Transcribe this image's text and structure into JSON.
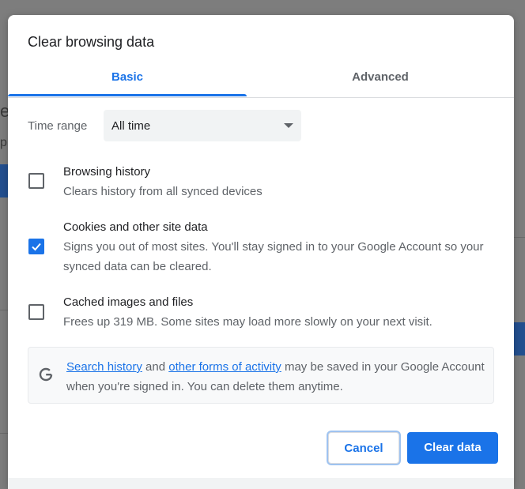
{
  "dialog": {
    "title": "Clear browsing data"
  },
  "tabs": [
    {
      "label": "Basic",
      "active": true
    },
    {
      "label": "Advanced",
      "active": false
    }
  ],
  "time_range": {
    "label": "Time range",
    "value": "All time"
  },
  "options": [
    {
      "title": "Browsing history",
      "description": "Clears history from all synced devices",
      "checked": false
    },
    {
      "title": "Cookies and other site data",
      "description": "Signs you out of most sites. You'll stay signed in to your Google Account so your synced data can be cleared.",
      "checked": true
    },
    {
      "title": "Cached images and files",
      "description": "Frees up 319 MB. Some sites may load more slowly on your next visit.",
      "checked": false
    }
  ],
  "info": {
    "link1": "Search history",
    "text1": "and",
    "link2": "other forms of activity",
    "text2": "may be saved in your Google Account when you're signed in. You can delete them anytime."
  },
  "buttons": {
    "cancel": "Cancel",
    "clear": "Clear data"
  },
  "colors": {
    "accent": "#1a73e8",
    "text": "#202124",
    "secondary_text": "#5f6368"
  }
}
